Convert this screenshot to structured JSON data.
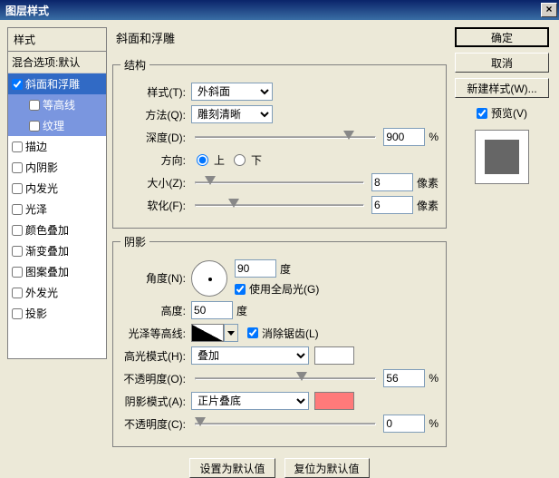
{
  "window": {
    "title": "图层样式"
  },
  "left": {
    "header": "样式",
    "blend_default": "混合选项:默认",
    "items": [
      {
        "label": "斜面和浮雕",
        "checked": true,
        "selected": true
      },
      {
        "label": "等高线",
        "checked": false,
        "sub": true
      },
      {
        "label": "纹理",
        "checked": false,
        "sub": true
      },
      {
        "label": "描边",
        "checked": false
      },
      {
        "label": "内阴影",
        "checked": false
      },
      {
        "label": "内发光",
        "checked": false
      },
      {
        "label": "光泽",
        "checked": false
      },
      {
        "label": "颜色叠加",
        "checked": false
      },
      {
        "label": "渐变叠加",
        "checked": false
      },
      {
        "label": "图案叠加",
        "checked": false
      },
      {
        "label": "外发光",
        "checked": false
      },
      {
        "label": "投影",
        "checked": false
      }
    ]
  },
  "panel": {
    "title": "斜面和浮雕",
    "structure": {
      "legend": "结构",
      "style_label": "样式(T):",
      "style_value": "外斜面",
      "technique_label": "方法(Q):",
      "technique_value": "雕刻清晰",
      "depth_label": "深度(D):",
      "depth_value": "900",
      "depth_unit": "%",
      "direction_label": "方向:",
      "up": "上",
      "down": "下",
      "size_label": "大小(Z):",
      "size_value": "8",
      "size_unit": "像素",
      "soften_label": "软化(F):",
      "soften_value": "6",
      "soften_unit": "像素"
    },
    "shading": {
      "legend": "阴影",
      "angle_label": "角度(N):",
      "angle_value": "90",
      "angle_unit": "度",
      "global_light": "使用全局光(G)",
      "altitude_label": "高度:",
      "altitude_value": "50",
      "altitude_unit": "度",
      "gloss_label": "光泽等高线:",
      "antialias": "消除锯齿(L)",
      "highlight_mode_label": "高光模式(H):",
      "highlight_mode_value": "叠加",
      "highlight_opacity_label": "不透明度(O):",
      "highlight_opacity_value": "56",
      "opacity_unit": "%",
      "shadow_mode_label": "阴影模式(A):",
      "shadow_mode_value": "正片叠底",
      "shadow_opacity_label": "不透明度(C):",
      "shadow_opacity_value": "0",
      "shadow_color": "#FF7A7A",
      "highlight_color": "#FFFFFF"
    },
    "reset_btn": "设置为默认值",
    "restore_btn": "复位为默认值"
  },
  "right": {
    "ok": "确定",
    "cancel": "取消",
    "new_style": "新建样式(W)...",
    "preview": "预览(V)"
  }
}
